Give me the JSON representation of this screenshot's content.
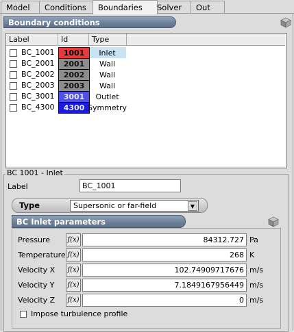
{
  "tabs": [
    {
      "label": "Model"
    },
    {
      "label": "Conditions"
    },
    {
      "label": "Boundaries"
    },
    {
      "label": "Solver"
    },
    {
      "label": "Out"
    }
  ],
  "active_tab": "Boundaries",
  "boundary_section": {
    "title": "Boundary conditions"
  },
  "table": {
    "columns": [
      "Label",
      "Id",
      "Type"
    ],
    "rows": [
      {
        "label": "BC_1001",
        "id": "1001",
        "type": "Inlet",
        "color": "#e83a3a",
        "selected": true
      },
      {
        "label": "BC_2001",
        "id": "2001",
        "type": "Wall",
        "color": "#8c8c8c"
      },
      {
        "label": "BC_2002",
        "id": "2002",
        "type": "Wall",
        "color": "#8c8c8c"
      },
      {
        "label": "BC_2003",
        "id": "2003",
        "type": "Wall",
        "color": "#8c8c8c"
      },
      {
        "label": "BC_3001",
        "id": "3001",
        "type": "Outlet",
        "color": "#5050e8"
      },
      {
        "label": "BC_4300",
        "id": "4300",
        "type": "Symmetry",
        "color": "#1a1ae0"
      }
    ]
  },
  "detail": {
    "group_title": "BC 1001 -  Inlet",
    "label_caption": "Label",
    "label_value": "BC_1001",
    "type_caption": "Type",
    "type_value": "Supersonic or far-field"
  },
  "inlet": {
    "title": "BC Inlet parameters",
    "fx_label": "f(x)",
    "params": [
      {
        "name": "Pressure",
        "value": "84312.727",
        "unit": "Pa"
      },
      {
        "name": "Temperature",
        "value": "268",
        "unit": "K"
      },
      {
        "name": "Velocity X",
        "value": "102.74909717676",
        "unit": "m/s"
      },
      {
        "name": "Velocity Y",
        "value": "7.1849167956449",
        "unit": "m/s"
      },
      {
        "name": "Velocity Z",
        "value": "0",
        "unit": "m/s"
      }
    ],
    "turbulence_label": "Impose turbulence profile"
  },
  "colors": {
    "header_bar": "#6d7f97",
    "selected_row": "#c9e3f5"
  }
}
